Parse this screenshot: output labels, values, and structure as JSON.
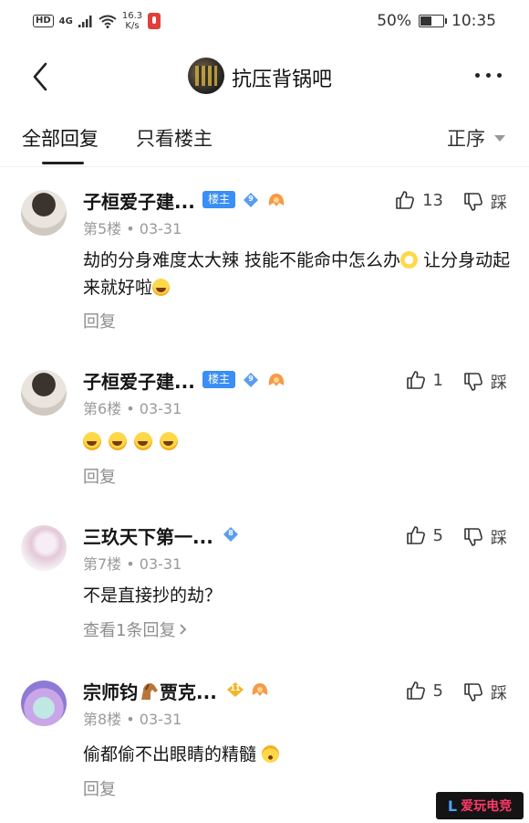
{
  "status_bar": {
    "hd": "HD",
    "net": "4G",
    "speed_value": "16.3",
    "speed_unit": "K/s",
    "battery_pct": "50%",
    "battery_level": 0.5,
    "time": "10:35"
  },
  "nav": {
    "title": "抗压背锅吧"
  },
  "tabs": {
    "all": "全部回复",
    "owner_only": "只看楼主",
    "sort": "正序"
  },
  "posts": [
    {
      "username": "子桓爱子建...",
      "owner_badge": "楼主",
      "level": "9",
      "floor": "第5楼",
      "date": "03-31",
      "likes": "13",
      "dislike_label": "踩",
      "content_a": "劫的分身难度太大辣 技能不能命中怎么办",
      "content_b": " 让分身动起来就好啦",
      "reply_label": "回复"
    },
    {
      "username": "子桓爱子建...",
      "owner_badge": "楼主",
      "level": "9",
      "floor": "第6楼",
      "date": "03-31",
      "likes": "1",
      "dislike_label": "踩",
      "reply_label": "回复"
    },
    {
      "username": "三玖天下第一...",
      "level": "8",
      "floor": "第7楼",
      "date": "03-31",
      "likes": "5",
      "dislike_label": "踩",
      "content": "不是直接抄的劫？",
      "reply_label": "查看1条回复"
    },
    {
      "username_a": "宗师钧",
      "username_b": "贾克...",
      "level": "11",
      "floor": "第8楼",
      "date": "03-31",
      "likes": "5",
      "dislike_label": "踩",
      "content": "偷都偷不出眼睛的精髓",
      "reply_label": "回复"
    }
  ],
  "watermark": "爱玩电竞",
  "colors": {
    "owner_badge": "#3a8ef5",
    "level_badge": "#5b9cf0",
    "meta_grey": "#9a9a9a"
  }
}
